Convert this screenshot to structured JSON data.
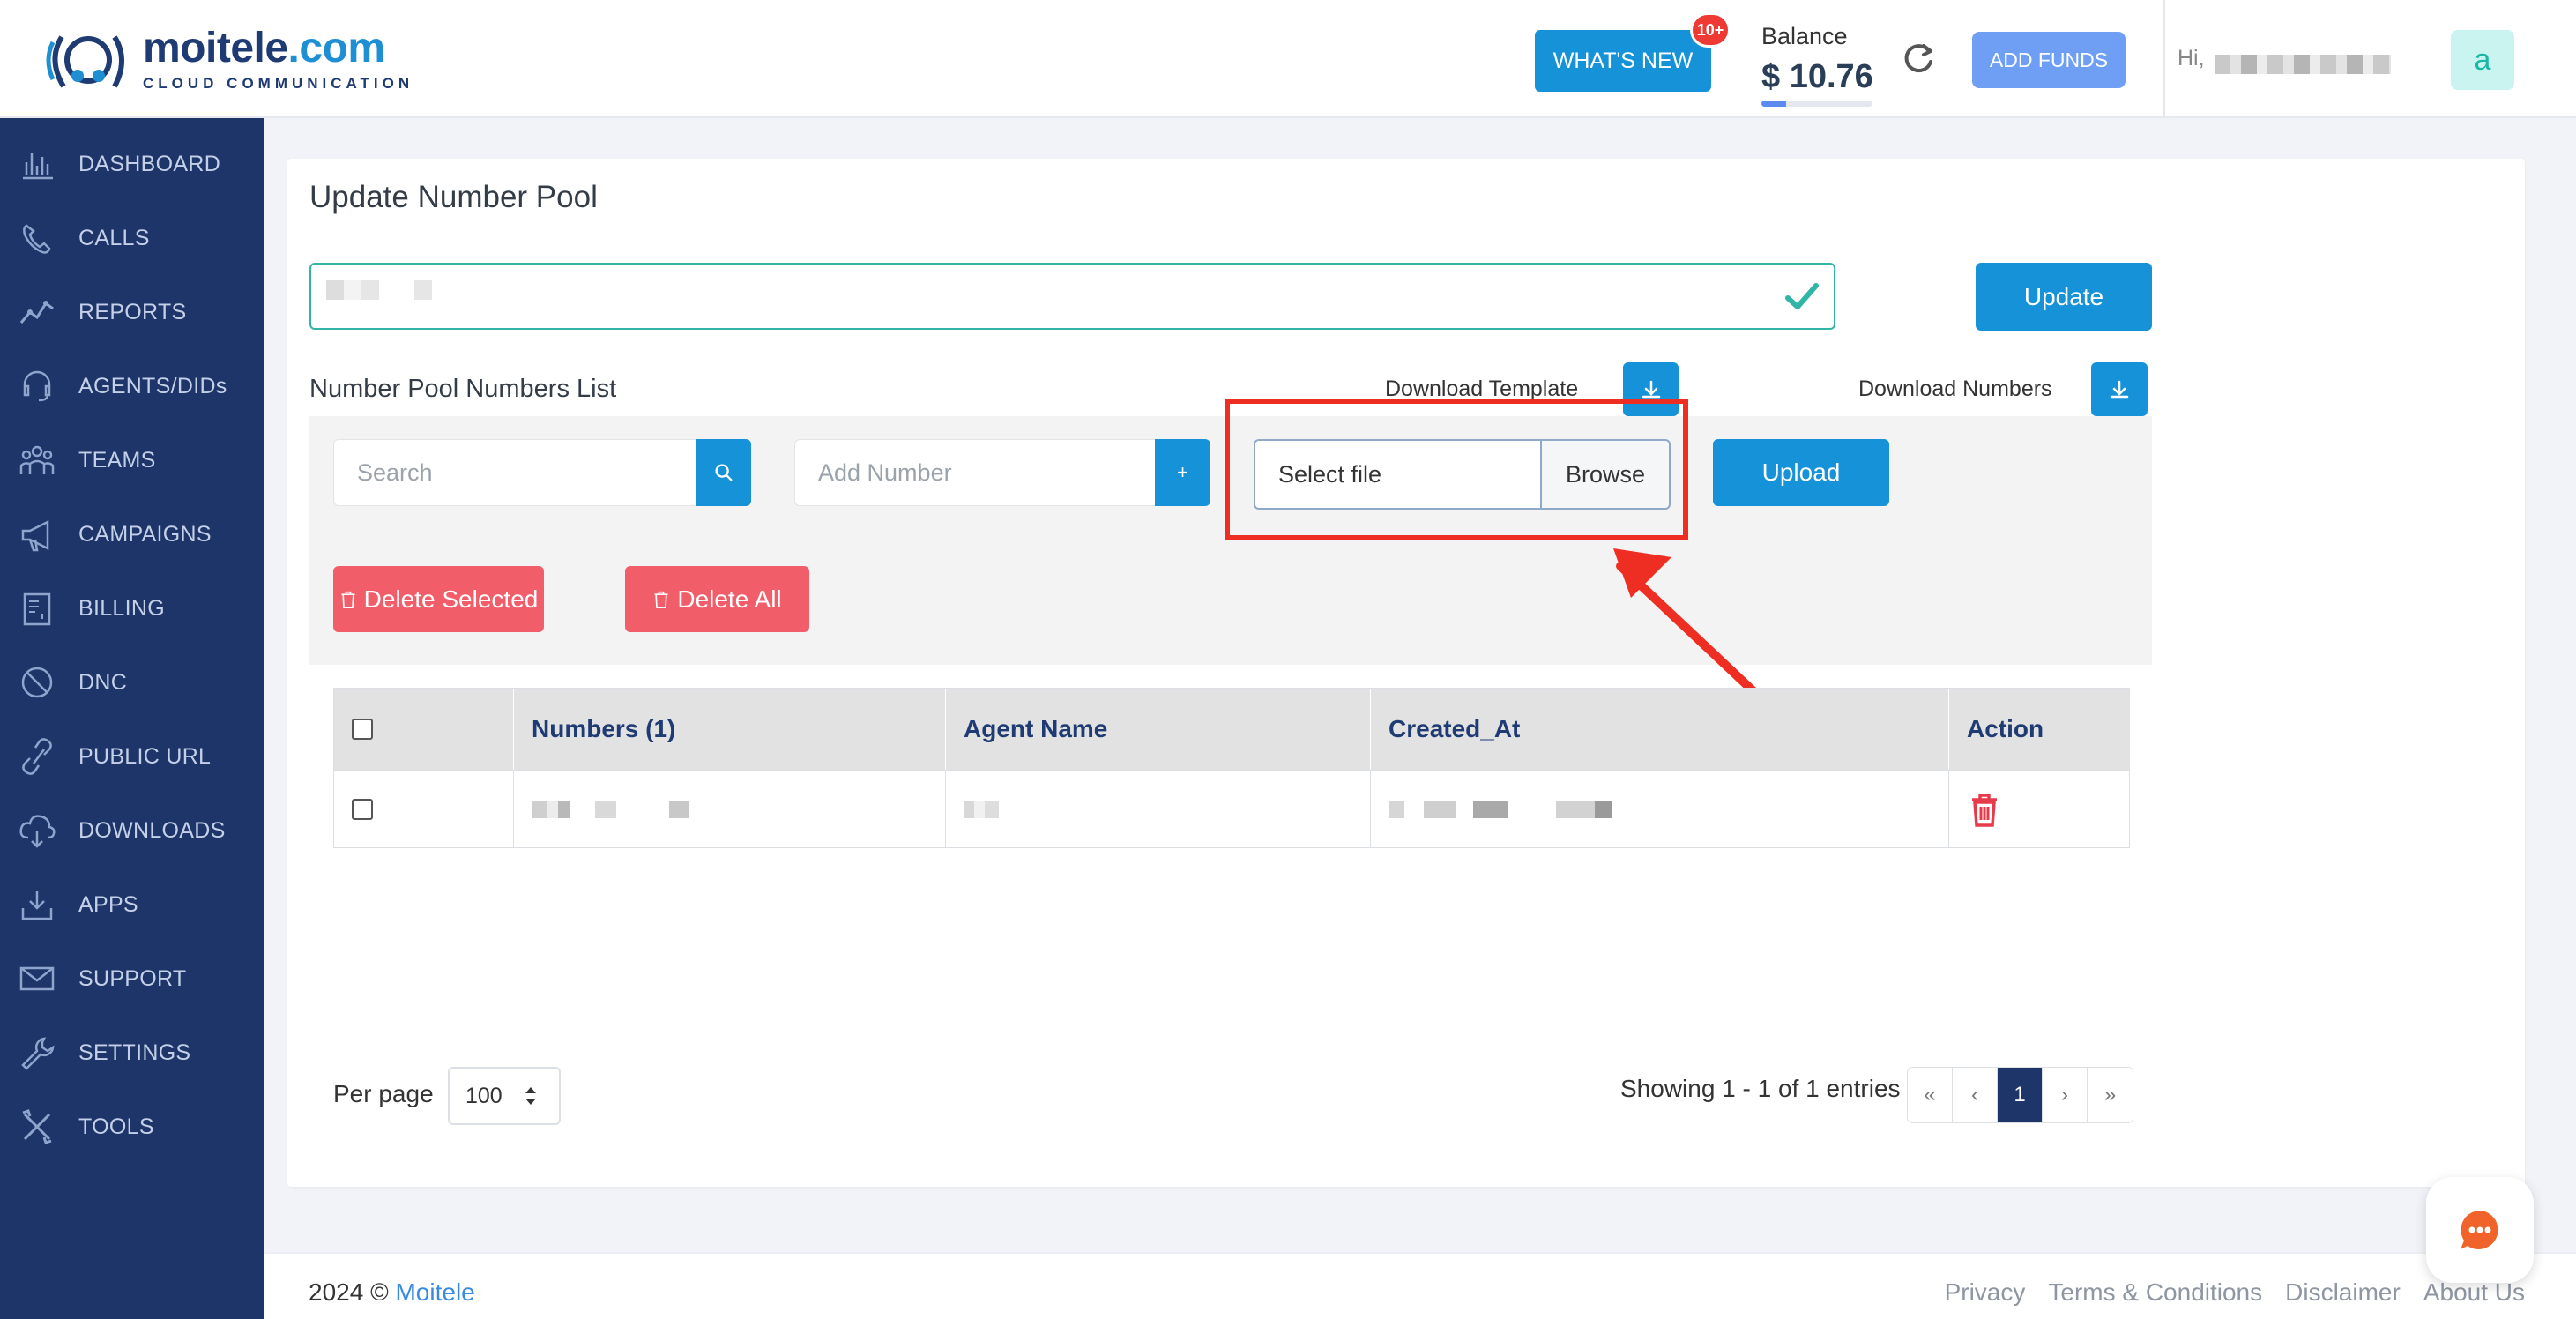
{
  "brand": {
    "name_left": "moitele",
    "name_dot": ".com",
    "tagline": "CLOUD COMMUNICATION"
  },
  "header": {
    "whats_new": "WHAT'S NEW",
    "whats_new_badge": "10+",
    "balance_label": "Balance",
    "balance_value": "$ 10.76",
    "balance_fraction": 0.22,
    "add_funds": "ADD FUNDS",
    "greeting": "Hi,",
    "avatar_letter": "a"
  },
  "sidebar": {
    "items": [
      {
        "label": "DASHBOARD",
        "icon": "dashboard-icon"
      },
      {
        "label": "CALLS",
        "icon": "phone-icon"
      },
      {
        "label": "REPORTS",
        "icon": "chart-icon"
      },
      {
        "label": "AGENTS/DIDs",
        "icon": "headset-icon"
      },
      {
        "label": "TEAMS",
        "icon": "team-icon"
      },
      {
        "label": "CAMPAIGNS",
        "icon": "megaphone-icon"
      },
      {
        "label": "BILLING",
        "icon": "invoice-icon"
      },
      {
        "label": "DNC",
        "icon": "ban-icon"
      },
      {
        "label": "PUBLIC URL",
        "icon": "link-icon"
      },
      {
        "label": "DOWNLOADS",
        "icon": "cloud-download-icon"
      },
      {
        "label": "APPS",
        "icon": "download-tray-icon"
      },
      {
        "label": "SUPPORT",
        "icon": "envelope-icon"
      },
      {
        "label": "SETTINGS",
        "icon": "wrench-icon"
      },
      {
        "label": "TOOLS",
        "icon": "tools-icon"
      }
    ]
  },
  "page": {
    "title": "Update Number Pool",
    "update_button": "Update",
    "list_title": "Number Pool Numbers List",
    "download_template": "Download Template",
    "download_numbers": "Download Numbers",
    "search_placeholder": "Search",
    "add_number_placeholder": "Add Number",
    "add_number_button": "+",
    "file_placeholder": "Select file",
    "browse": "Browse",
    "upload": "Upload",
    "delete_selected": "Delete Selected",
    "delete_all": "Delete All"
  },
  "table": {
    "headers": [
      "",
      "Numbers (1)",
      "Agent Name",
      "Created_At",
      "Action"
    ]
  },
  "pagination": {
    "per_page_label": "Per page",
    "per_page_value": "100",
    "showing": "Showing 1 - 1 of 1 entries",
    "pages": [
      "«",
      "‹",
      "1",
      "›",
      "»"
    ],
    "active_page": "1"
  },
  "footer": {
    "year": "2024 ©",
    "brand": "Moitele",
    "links": [
      "Privacy",
      "Terms & Conditions",
      "Disclaimer",
      "About Us"
    ]
  },
  "colors": {
    "primary": "#1592d8",
    "sidebar": "#1d3568",
    "danger": "#f25d6a",
    "highlight": "#ee2e22",
    "success": "#32b5a6"
  }
}
